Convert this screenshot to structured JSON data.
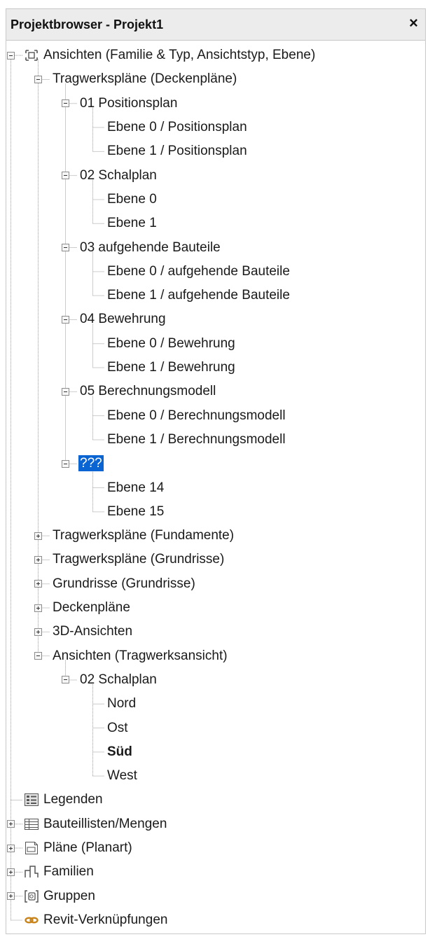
{
  "panel": {
    "title": "Projektbrowser - Projekt1",
    "close_label": "×"
  },
  "tree": [
    {
      "label": "Ansichten (Familie & Typ, Ansichtstyp, Ebene)",
      "level": 0,
      "toggle": "minus",
      "icon": "views-icon"
    },
    {
      "label": "Tragwerkspläne (Deckenpläne)",
      "level": 1,
      "toggle": "minus"
    },
    {
      "label": "01 Positionsplan",
      "level": 2,
      "toggle": "minus"
    },
    {
      "label": "Ebene 0 / Positionsplan",
      "level": 3
    },
    {
      "label": "Ebene 1 / Positionsplan",
      "level": 3
    },
    {
      "label": "02 Schalplan",
      "level": 2,
      "toggle": "minus"
    },
    {
      "label": "Ebene 0",
      "level": 3
    },
    {
      "label": "Ebene 1",
      "level": 3
    },
    {
      "label": "03 aufgehende Bauteile",
      "level": 2,
      "toggle": "minus"
    },
    {
      "label": "Ebene 0 / aufgehende Bauteile",
      "level": 3
    },
    {
      "label": "Ebene 1 / aufgehende Bauteile",
      "level": 3
    },
    {
      "label": "04 Bewehrung",
      "level": 2,
      "toggle": "minus"
    },
    {
      "label": "Ebene 0 / Bewehrung",
      "level": 3
    },
    {
      "label": "Ebene 1 / Bewehrung",
      "level": 3
    },
    {
      "label": "05 Berechnungsmodell",
      "level": 2,
      "toggle": "minus"
    },
    {
      "label": "Ebene 0 / Berechnungsmodell",
      "level": 3
    },
    {
      "label": "Ebene 1 / Berechnungsmodell",
      "level": 3
    },
    {
      "label": "???",
      "level": 2,
      "toggle": "minus",
      "selected": true
    },
    {
      "label": "Ebene 14",
      "level": 3
    },
    {
      "label": "Ebene 15",
      "level": 3
    },
    {
      "label": "Tragwerkspläne (Fundamente)",
      "level": 1,
      "toggle": "plus"
    },
    {
      "label": "Tragwerkspläne (Grundrisse)",
      "level": 1,
      "toggle": "plus"
    },
    {
      "label": "Grundrisse (Grundrisse)",
      "level": 1,
      "toggle": "plus"
    },
    {
      "label": "Deckenpläne",
      "level": 1,
      "toggle": "plus"
    },
    {
      "label": "3D-Ansichten",
      "level": 1,
      "toggle": "plus"
    },
    {
      "label": "Ansichten (Tragwerksansicht)",
      "level": 1,
      "toggle": "minus"
    },
    {
      "label": "02 Schalplan",
      "level": 2,
      "toggle": "minus"
    },
    {
      "label": "Nord",
      "level": 3
    },
    {
      "label": "Ost",
      "level": 3
    },
    {
      "label": "Süd",
      "level": 3,
      "bold": true
    },
    {
      "label": "West",
      "level": 3
    },
    {
      "label": "Legenden",
      "level": 0,
      "icon": "legend-icon"
    },
    {
      "label": "Bauteillisten/Mengen",
      "level": 0,
      "toggle": "plus",
      "icon": "schedule-icon"
    },
    {
      "label": "Pläne (Planart)",
      "level": 0,
      "toggle": "plus",
      "icon": "sheet-icon"
    },
    {
      "label": "Familien",
      "level": 0,
      "toggle": "plus",
      "icon": "family-icon"
    },
    {
      "label": "Gruppen",
      "level": 0,
      "toggle": "plus",
      "icon": "group-icon"
    },
    {
      "label": "Revit-Verknüpfungen",
      "level": 0,
      "icon": "link-icon"
    }
  ],
  "colors": {
    "selection": "#0a64d2",
    "connector": "#9a9a9a",
    "link_icon": "#c8841a"
  }
}
